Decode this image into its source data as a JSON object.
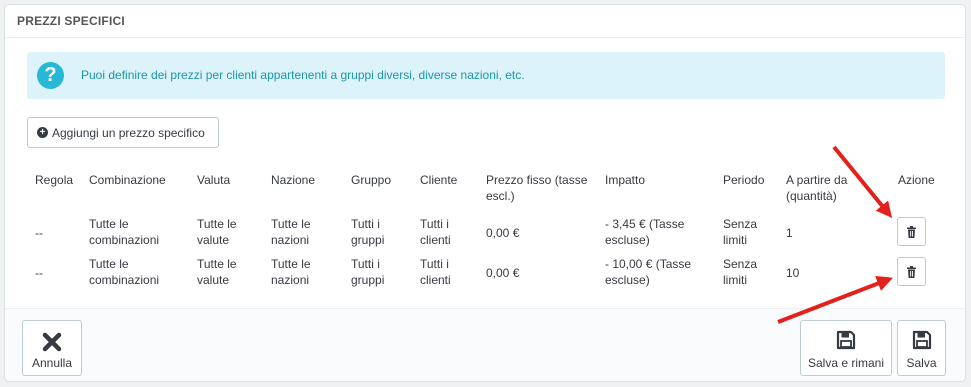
{
  "panel": {
    "title": "PREZZI SPECIFICI"
  },
  "alert": {
    "icon": "question-icon",
    "icon_glyph": "?",
    "text": "Puoi definire dei prezzi per clienti appartenenti a gruppi diversi, diverse nazioni, etc."
  },
  "add_button": {
    "label": "Aggiungi un prezzo specifico",
    "icon": "plus-circle-icon",
    "icon_glyph": "+"
  },
  "table": {
    "headers": {
      "rule": "Regola",
      "combination": "Combinazione",
      "currency": [
        "Valuta"
      ],
      "country": [
        "Nazione"
      ],
      "group": [
        "Gruppo"
      ],
      "customer": [
        "Cliente"
      ],
      "fixed_price": [
        "Prezzo fisso (tasse",
        "escl.)"
      ],
      "impact": [
        "Impatto"
      ],
      "period": [
        "Periodo"
      ],
      "from_qty": [
        "A partire da",
        "(quantità)"
      ],
      "action": "Azione"
    },
    "rows": [
      {
        "rule": "--",
        "combination": [
          "Tutte le",
          "combinazioni"
        ],
        "currency": [
          "Tutte le",
          "valute"
        ],
        "country": [
          "Tutte le",
          "nazioni"
        ],
        "group": [
          "Tutti i",
          "gruppi"
        ],
        "customer": [
          "Tutti i",
          "clienti"
        ],
        "fixed_price": "0,00 €",
        "impact": [
          "- 3,45 € (Tasse",
          "escluse)"
        ],
        "period": [
          "Senza",
          "limiti"
        ],
        "from_qty": "1"
      },
      {
        "rule": "--",
        "combination": [
          "Tutte le",
          "combinazioni"
        ],
        "currency": [
          "Tutte le",
          "valute"
        ],
        "country": [
          "Tutte le",
          "nazioni"
        ],
        "group": [
          "Tutti i",
          "gruppi"
        ],
        "customer": [
          "Tutti i",
          "clienti"
        ],
        "fixed_price": "0,00 €",
        "impact": [
          "- 10,00 € (Tasse",
          "escluse)"
        ],
        "period": [
          "Senza",
          "limiti"
        ],
        "from_qty": "10"
      }
    ],
    "delete_icon": "trash-icon"
  },
  "footer": {
    "cancel": {
      "label": "Annulla",
      "icon": "close-x-icon"
    },
    "save_stay": {
      "label": "Salva e rimani",
      "icon": "floppy-disk-icon"
    },
    "save": {
      "label": "Salva",
      "icon": "floppy-disk-icon"
    }
  },
  "annotations": {
    "arrow_color": "#e3201b"
  },
  "colors": {
    "info_bg": "#dcf4f9",
    "info_text": "#1e94ab",
    "info_icon": "#25b9d7"
  }
}
